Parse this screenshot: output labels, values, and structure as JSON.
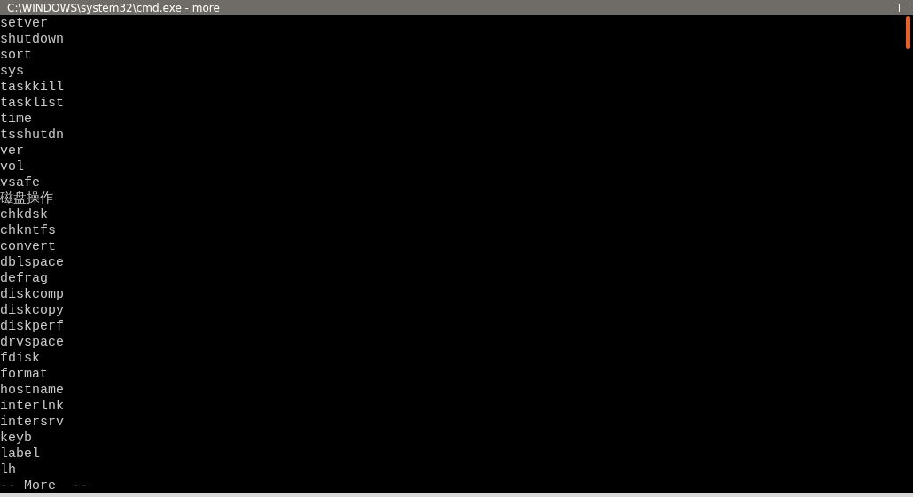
{
  "window": {
    "title": "C:\\WINDOWS\\system32\\cmd.exe - more"
  },
  "console": {
    "lines": [
      "setver",
      "shutdown",
      "sort",
      "sys",
      "taskkill",
      "tasklist",
      "time",
      "tsshutdn",
      "ver",
      "vol",
      "vsafe",
      "磁盘操作",
      "chkdsk",
      "chkntfs",
      "convert",
      "dblspace",
      "defrag",
      "diskcomp",
      "diskcopy",
      "diskperf",
      "drvspace",
      "fdisk",
      "format",
      "hostname",
      "interlnk",
      "intersrv",
      "keyb",
      "label",
      "lh"
    ],
    "prompt": "-- More  --"
  }
}
